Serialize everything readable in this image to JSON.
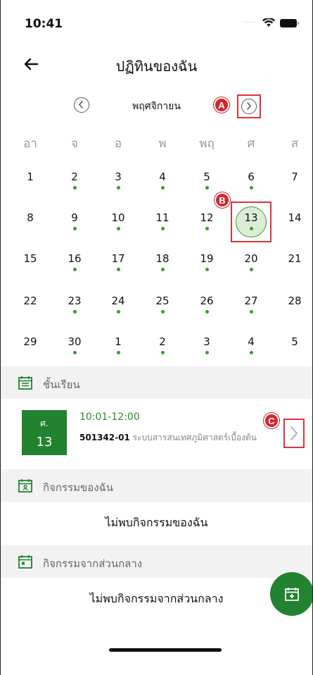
{
  "status_bar": {
    "time": "10:41"
  },
  "nav": {
    "title": "ปฏิทินของฉัน"
  },
  "calendar": {
    "month_label": "พฤศจิกายน",
    "weekdays": [
      "อา",
      "จ",
      "อ",
      "พ",
      "พฤ",
      "ศ",
      "ส"
    ],
    "weeks": [
      [
        {
          "d": "1",
          "dot": false
        },
        {
          "d": "2",
          "dot": true
        },
        {
          "d": "3",
          "dot": true
        },
        {
          "d": "4",
          "dot": true
        },
        {
          "d": "5",
          "dot": true
        },
        {
          "d": "6",
          "dot": true
        },
        {
          "d": "7",
          "dot": false
        }
      ],
      [
        {
          "d": "8",
          "dot": false
        },
        {
          "d": "9",
          "dot": true
        },
        {
          "d": "10",
          "dot": true
        },
        {
          "d": "11",
          "dot": true
        },
        {
          "d": "12",
          "dot": true
        },
        {
          "d": "13",
          "dot": true,
          "selected": true
        },
        {
          "d": "14",
          "dot": false
        }
      ],
      [
        {
          "d": "15",
          "dot": false
        },
        {
          "d": "16",
          "dot": true
        },
        {
          "d": "17",
          "dot": true
        },
        {
          "d": "18",
          "dot": true
        },
        {
          "d": "19",
          "dot": true
        },
        {
          "d": "20",
          "dot": true
        },
        {
          "d": "21",
          "dot": false
        }
      ],
      [
        {
          "d": "22",
          "dot": false
        },
        {
          "d": "23",
          "dot": true
        },
        {
          "d": "24",
          "dot": true
        },
        {
          "d": "25",
          "dot": true
        },
        {
          "d": "26",
          "dot": true
        },
        {
          "d": "27",
          "dot": true
        },
        {
          "d": "28",
          "dot": false
        }
      ],
      [
        {
          "d": "29",
          "dot": false
        },
        {
          "d": "30",
          "dot": true
        },
        {
          "d": "1",
          "dot": true
        },
        {
          "d": "2",
          "dot": true
        },
        {
          "d": "3",
          "dot": true
        },
        {
          "d": "4",
          "dot": true
        },
        {
          "d": "5",
          "dot": false
        }
      ]
    ]
  },
  "markers": {
    "a": "A",
    "b": "B",
    "c": "C"
  },
  "classes_section": {
    "title": "ชั้นเรียน",
    "item": {
      "badge_dow": "ศ.",
      "badge_day": "13",
      "time": "10:01-12:00",
      "code": "501342-01",
      "name": "ระบบสารสนเทศภูมิศาสตร์เบื้องต้น"
    }
  },
  "my_activities": {
    "title": "กิจกรรมของฉัน",
    "empty": "ไม่พบกิจกรรมของฉัน"
  },
  "central_activities": {
    "title": "กิจกรรมจากส่วนกลาง",
    "empty": "ไม่พบกิจกรรมจากส่วนกลาง"
  },
  "colors": {
    "accent": "#21822f",
    "dot": "#3c9a2f",
    "highlight": "#e0323b"
  },
  "icons": {
    "back": "arrow-left-icon",
    "prev": "chevron-left-circle-icon",
    "next": "chevron-right-circle-icon",
    "fab": "calendar-add-icon"
  }
}
